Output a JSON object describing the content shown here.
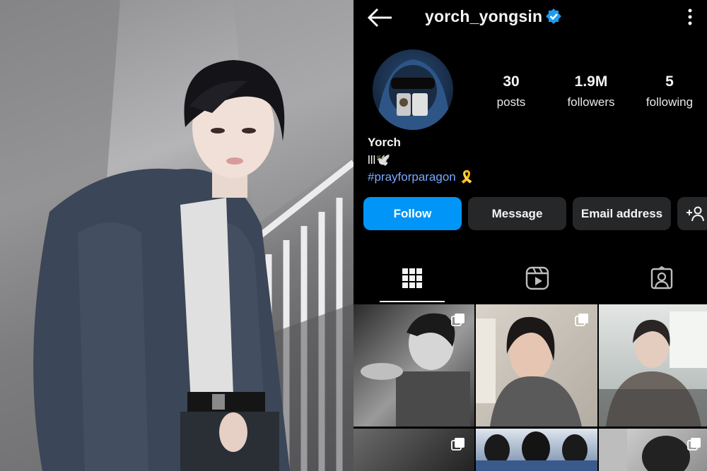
{
  "header": {
    "username": "yorch_yongsin",
    "icons": [
      "back-arrow-icon",
      "verified-badge-icon",
      "more-options-icon"
    ]
  },
  "stats": [
    {
      "value": "30",
      "label": "posts"
    },
    {
      "value": "1.9M",
      "label": "followers"
    },
    {
      "value": "5",
      "label": "following"
    }
  ],
  "profile": {
    "name": "Yorch",
    "bio_line": "lll🕊️",
    "hashtag": "#prayforparagon 🎗️"
  },
  "buttons": {
    "follow": "Follow",
    "message": "Message",
    "email": "Email address",
    "add_user_icon": "add-person-icon"
  },
  "tabs": [
    "grid-icon",
    "reels-icon",
    "tagged-icon"
  ],
  "colors": {
    "accent": "#0095f6",
    "hashtag": "#78a9ff",
    "verified": "#1d9bf0",
    "button_bg": "#262729",
    "background": "#000000"
  }
}
